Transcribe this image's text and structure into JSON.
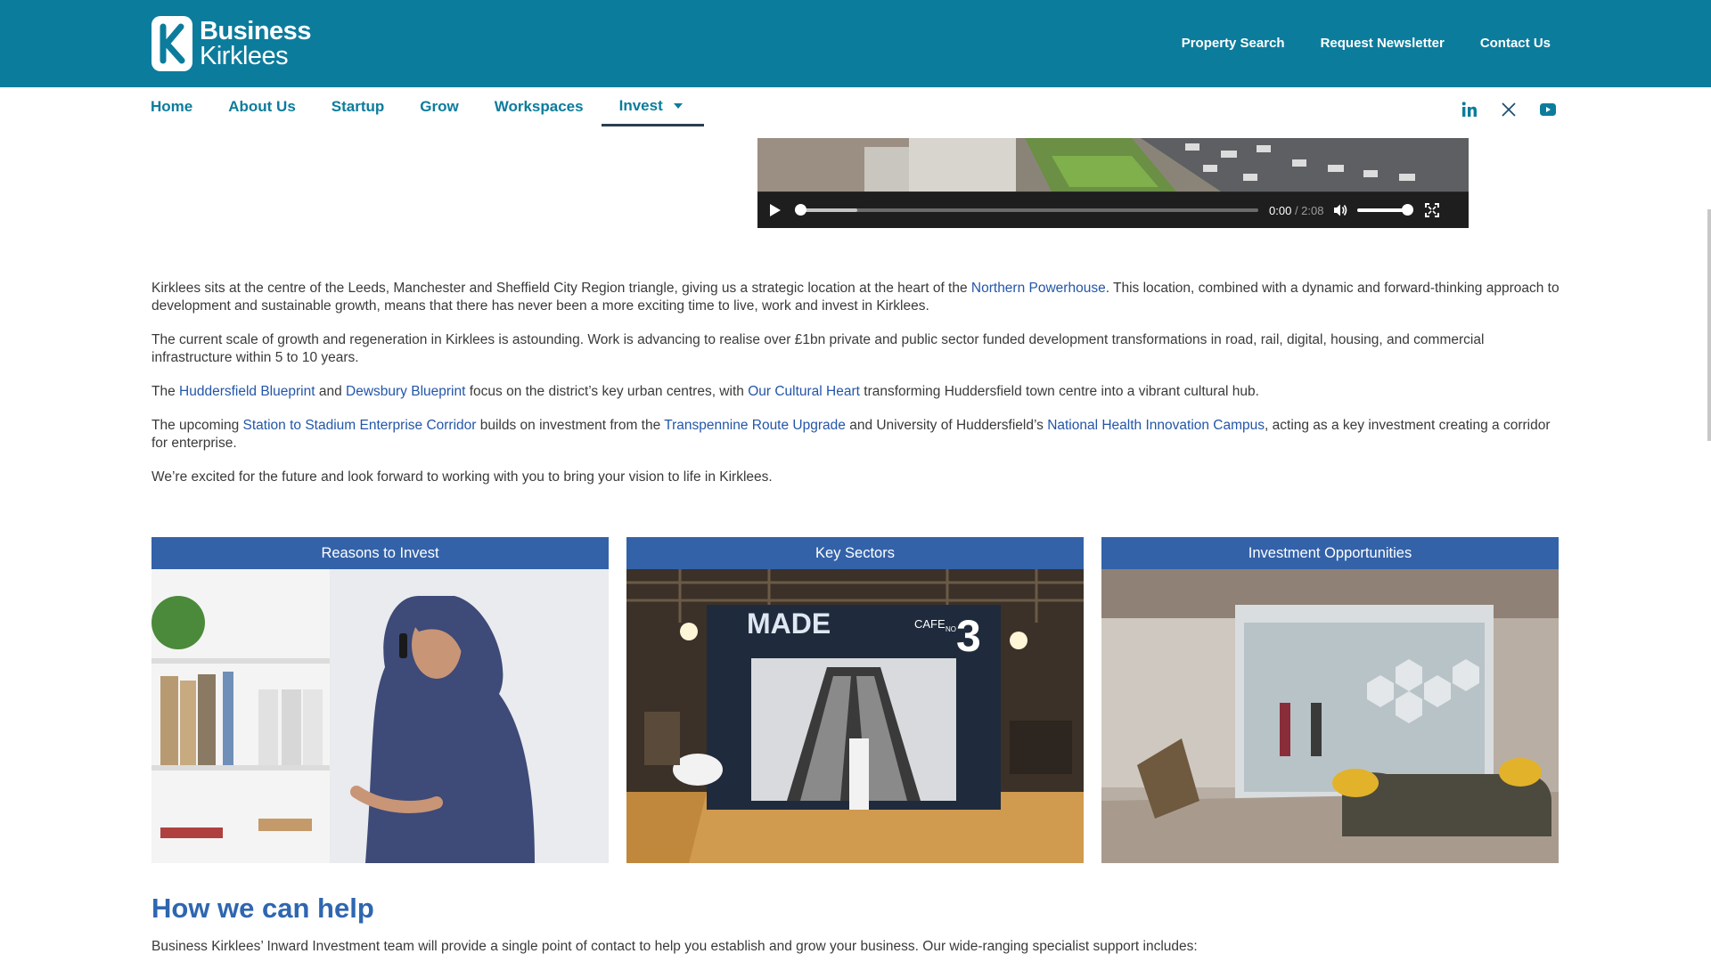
{
  "brand": {
    "line1": "Business",
    "line2": "Kirklees",
    "color": "#0c7c9c"
  },
  "top_links": [
    "Property Search",
    "Request Newsletter",
    "Contact Us"
  ],
  "nav": [
    {
      "label": "Home"
    },
    {
      "label": "About Us"
    },
    {
      "label": "Startup"
    },
    {
      "label": "Grow"
    },
    {
      "label": "Workspaces"
    },
    {
      "label": "Invest",
      "active": true,
      "has_dropdown": true
    }
  ],
  "social": [
    "linkedin-icon",
    "x-icon",
    "youtube-icon"
  ],
  "video": {
    "current_time": "0:00",
    "duration": "2:08",
    "progress": 0,
    "volume": 1.0
  },
  "paragraphs": {
    "p1": {
      "t1": "Kirklees sits at the centre of the Leeds, Manchester and Sheffield City Region triangle, giving us a strategic location at the heart of the ",
      "l1": "Northern Powerhouse",
      "t2": ". This location, combined with a dynamic and forward-thinking approach to development and sustainable growth, means that there has never been a more exciting time to live, work and invest in Kirklees."
    },
    "p2": "The current scale of growth and regeneration in Kirklees is astounding. Work is advancing to realise over £1bn private and public sector funded development transformations in road, rail, digital, housing, and commercial infrastructure within 5 to 10 years.",
    "p3": {
      "t1": "The ",
      "l1": "Huddersfield Blueprint",
      "t2": " and ",
      "l2": "Dewsbury Blueprint",
      "t3": " focus on the district’s key urban centres, with ",
      "l3": "Our Cultural Heart",
      "t4": " transforming Huddersfield town centre into a vibrant cultural hub."
    },
    "p4": {
      "t1": "The upcoming ",
      "l1": "Station to Stadium Enterprise Corridor",
      "t2": " builds on investment from the ",
      "l2": "Transpennine Route Upgrade",
      "t3": " and University of Huddersfield’s ",
      "l3": "National Health Innovation Campus",
      "t4": ", acting as a key investment creating a corridor for enterprise."
    },
    "p5": "We’re excited for the future and look forward to working with you to bring your vision to life in Kirklees."
  },
  "cards": [
    {
      "title": "Reasons to Invest"
    },
    {
      "title": "Key Sectors",
      "sign_main": "MADE",
      "sign_cafe": "CAFE",
      "sign_no": "NO",
      "sign_num": "3"
    },
    {
      "title": "Investment Opportunities"
    }
  ],
  "help": {
    "title": "How we can help",
    "text": "Business Kirklees’ Inward Investment team will provide a single point of contact to help you establish and grow your business. Our wide-ranging specialist support includes:"
  }
}
